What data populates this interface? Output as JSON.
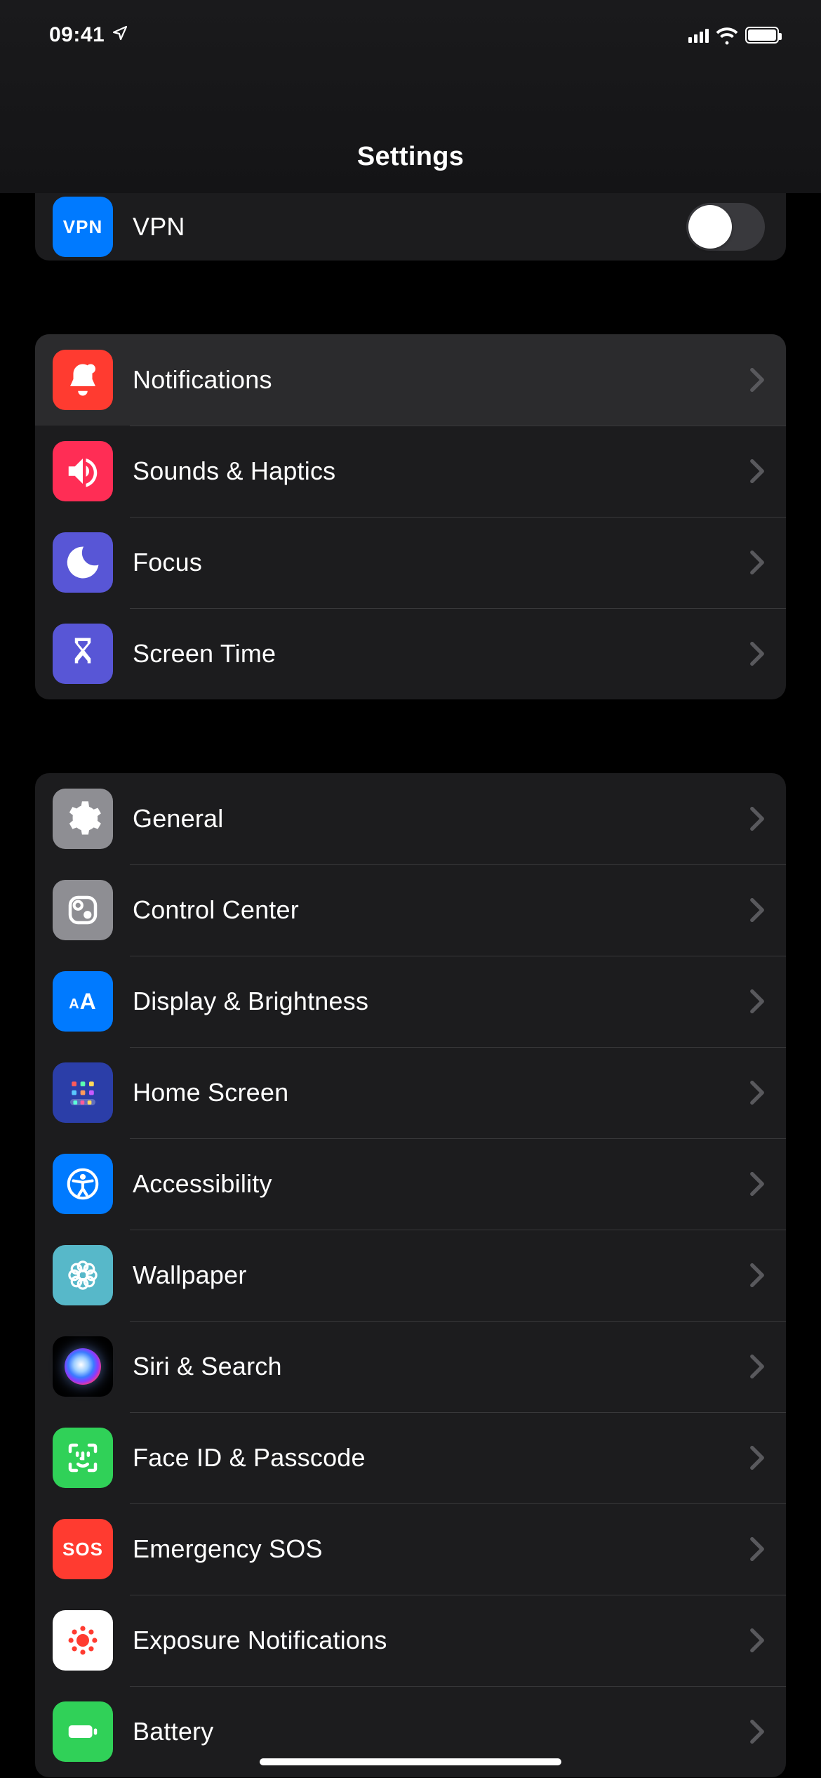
{
  "status": {
    "time": "09:41"
  },
  "header": {
    "title": "Settings"
  },
  "group0": {
    "vpn": {
      "label": "VPN",
      "icon_text": "VPN",
      "toggle_on": false
    }
  },
  "group1": {
    "notifications": {
      "label": "Notifications"
    },
    "sounds": {
      "label": "Sounds & Haptics"
    },
    "focus": {
      "label": "Focus"
    },
    "screentime": {
      "label": "Screen Time"
    }
  },
  "group2": {
    "general": {
      "label": "General"
    },
    "controlcenter": {
      "label": "Control Center"
    },
    "display": {
      "label": "Display & Brightness",
      "icon_text": "AA"
    },
    "homescreen": {
      "label": "Home Screen"
    },
    "accessibility": {
      "label": "Accessibility"
    },
    "wallpaper": {
      "label": "Wallpaper"
    },
    "siri": {
      "label": "Siri & Search"
    },
    "faceid": {
      "label": "Face ID & Passcode"
    },
    "sos": {
      "label": "Emergency SOS",
      "icon_text": "SOS"
    },
    "exposure": {
      "label": "Exposure Notifications"
    },
    "battery": {
      "label": "Battery"
    }
  }
}
